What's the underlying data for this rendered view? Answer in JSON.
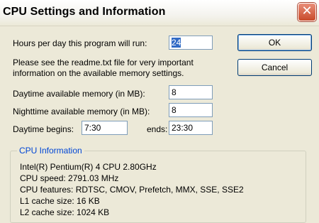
{
  "window": {
    "title": "CPU Settings and Information",
    "close_glyph": "✕"
  },
  "form": {
    "hours_label": "Hours per day this program will run:",
    "hours_value": "24",
    "readme_note_line1": "Please see the readme.txt file for very important",
    "readme_note_line2": "information on the available memory settings.",
    "daytime_memory_label": "Daytime available memory  (in MB):",
    "daytime_memory_value": "8",
    "nighttime_memory_label": "Nighttime available memory  (in MB):",
    "nighttime_memory_value": "8",
    "daytime_begins_label": "Daytime begins:",
    "daytime_begins_value": "7:30",
    "ends_label": "ends:",
    "ends_value": "23:30"
  },
  "buttons": {
    "ok": "OK",
    "cancel": "Cancel"
  },
  "cpu_info": {
    "group_title": "CPU Information",
    "processor": "Intel(R) Pentium(R) 4 CPU 2.80GHz",
    "speed": "CPU speed: 2791.03 MHz",
    "features": "CPU features: RDTSC, CMOV, Prefetch, MMX, SSE, SSE2",
    "l1_cache": "L1 cache size: 16 KB",
    "l2_cache": "L2 cache size: 1024 KB"
  },
  "colors": {
    "dialog_background": "#ece9d8",
    "close_button": "#c84b2a",
    "selection_highlight": "#316ac5",
    "group_title_text": "#0046d5"
  },
  "icons": {
    "close": "close-icon"
  }
}
